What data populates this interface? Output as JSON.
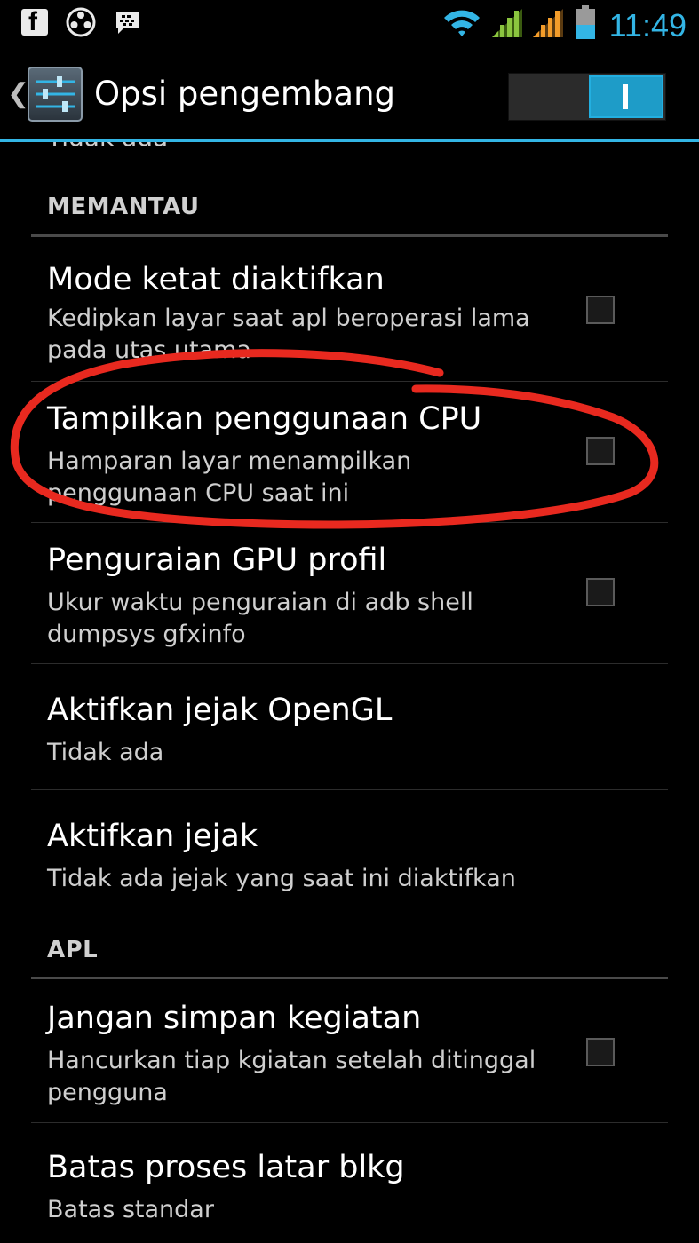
{
  "status_bar": {
    "time": "11:49",
    "left_icons": [
      "facebook-icon",
      "film-reel-icon",
      "bbm-icon"
    ],
    "right_icons": [
      "wifi-icon",
      "signal-icon",
      "signal-icon",
      "battery-icon"
    ],
    "accent": "#33b5e5"
  },
  "action_bar": {
    "title": "Opsi pengembang",
    "switch_state": "on",
    "accent": "#33b5e5"
  },
  "list": {
    "clipped_summary": "Tidak ada",
    "categories": [
      {
        "label": "MEMANTAU"
      },
      {
        "label": "APL"
      }
    ],
    "items": [
      {
        "title": "Mode ketat diaktifkan",
        "summary": "Kedipkan layar saat apl beroperasi lama pada utas utama",
        "checkbox": true,
        "checked": false
      },
      {
        "title": "Tampilkan penggunaan CPU",
        "summary": "Hamparan layar menampilkan penggunaan CPU saat ini",
        "checkbox": true,
        "checked": false
      },
      {
        "title": "Penguraian GPU profil",
        "summary": "Ukur waktu penguraian di adb shell dumpsys gfxinfo",
        "checkbox": true,
        "checked": false
      },
      {
        "title": "Aktifkan jejak OpenGL",
        "summary": "Tidak ada",
        "checkbox": false
      },
      {
        "title": "Aktifkan jejak",
        "summary": "Tidak ada jejak yang saat ini diaktifkan",
        "checkbox": false
      },
      {
        "title": "Jangan simpan kegiatan",
        "summary": "Hancurkan tiap kgiatan setelah ditinggal pengguna",
        "checkbox": true,
        "checked": false
      },
      {
        "title": "Batas proses latar blkg",
        "summary": "Batas standar",
        "checkbox": false
      }
    ]
  },
  "annotation": {
    "type": "freehand-circle",
    "color": "#e8291f",
    "target": "Tampilkan penggunaan CPU"
  }
}
